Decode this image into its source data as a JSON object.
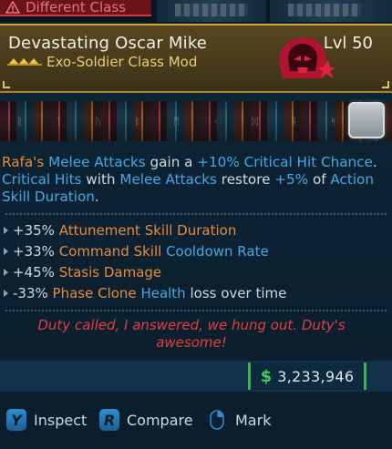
{
  "warning": {
    "label": "Different Class",
    "icon": "warning-triangle-icon",
    "color": "#e7727a"
  },
  "item": {
    "name": "Devastating Oscar Mike",
    "type": "Exo-Soldier Class Mod",
    "level": "Lvl 50",
    "rarity_color": "#c9a437",
    "icon": "hooded-soldier-icon"
  },
  "description": {
    "line1": {
      "character": "Rafa's",
      "melee1": "Melee Attacks",
      "gain": "gain a",
      "bonus": "+10% Critical Hit Chance",
      "end": "."
    },
    "line2": {
      "crit": "Critical Hits",
      "with": "with",
      "melee2": "Melee Attacks",
      "restore": "restore",
      "pct": "+5%",
      "of": "of",
      "action_skill": "Action Skill Duration",
      "end": "."
    }
  },
  "stats": [
    {
      "value": "+35%",
      "name": "Attunement Skill Duration",
      "suffix": "",
      "tail": ""
    },
    {
      "value": "+33%",
      "name": "Command Skill",
      "suffix": "Cooldown Rate",
      "tail": ""
    },
    {
      "value": "+45%",
      "name": "Stasis Damage",
      "suffix": "",
      "tail": ""
    },
    {
      "value": "-33%",
      "name": "Phase Clone",
      "suffix": "Health",
      "tail": "loss over time"
    }
  ],
  "flavor": "Duty called, I answered, we hung out. Duty's awesome!",
  "price": {
    "icon": "dollar-icon",
    "value": "3,233,946"
  },
  "actions": [
    {
      "key": "Y",
      "label": "Inspect"
    },
    {
      "key": "R",
      "label": "Compare"
    },
    {
      "key": "mouse-right-icon",
      "label": "Mark"
    }
  ],
  "colors": {
    "orange_highlight": "#e88a3a",
    "blue_highlight": "#45a9e4",
    "flavor": "#e83c3f",
    "money": "#3fcf55"
  }
}
